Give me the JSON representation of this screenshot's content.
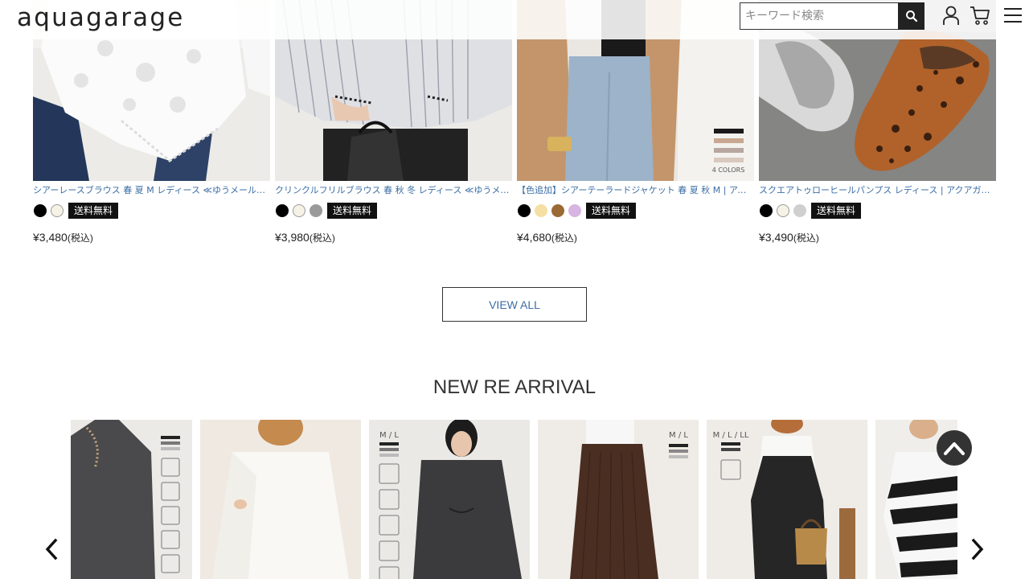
{
  "header": {
    "logo": "aquagarage",
    "search_placeholder": "キーワード検索"
  },
  "products": [
    {
      "name": "シアーレースブラウス 春 夏 M レディース ≪ゆうメール便配送...",
      "colors": [
        "#000000",
        "#f6f2e6"
      ],
      "badge": "送料無料",
      "price": "¥3,480",
      "tax": "(税込)"
    },
    {
      "name": "クリンクルフリルブラウス 春 秋 冬 レディース ≪ゆうメール便...",
      "colors": [
        "#000000",
        "#f6f2e6",
        "#9a9a9a"
      ],
      "badge": "送料無料",
      "price": "¥3,980",
      "tax": "(税込)"
    },
    {
      "name": "【色追加】シアーテーラードジャケット 春 夏 秋 M | アクアガ...",
      "colors": [
        "#000000",
        "#f6dfa4",
        "#9a6a35",
        "#d8b4e2"
      ],
      "badge": "送料無料",
      "price": "¥4,680",
      "tax": "(税込)"
    },
    {
      "name": "スクエアトゥローヒールパンプス レディース | アクアガレージ...",
      "colors": [
        "#000000",
        "#f6f2e6",
        "#cfcfcf"
      ],
      "badge": "送料無料",
      "price": "¥3,490",
      "tax": "(税込)"
    }
  ],
  "product_image_text": {
    "color_count": "4 COLORS"
  },
  "view_all": "VIEW ALL",
  "new_arrival": {
    "title": "NEW RE ARRIVAL",
    "size_tags": [
      "M / L",
      "M / L",
      "M / L / LL"
    ]
  }
}
